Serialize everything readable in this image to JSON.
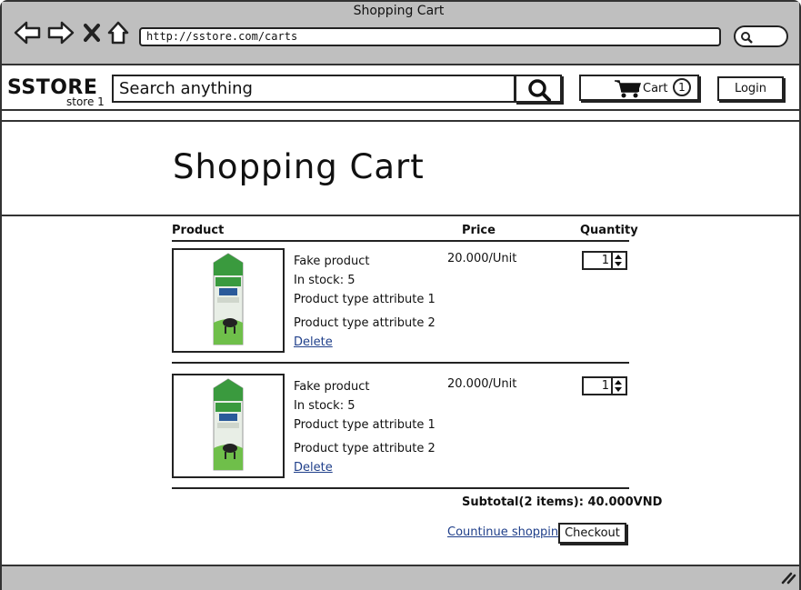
{
  "window": {
    "title": "Shopping Cart",
    "url": "http://sstore.com/carts"
  },
  "header": {
    "logo": "SSTORE",
    "store_label": "store 1",
    "search_placeholder": "Search anything",
    "cart_label": "Cart",
    "cart_count": "1",
    "login_label": "Login"
  },
  "page": {
    "title": "Shopping Cart"
  },
  "table": {
    "headers": {
      "product": "Product",
      "price": "Price",
      "quantity": "Quantity"
    },
    "items": [
      {
        "name": "Fake product",
        "stock": "In stock: 5",
        "attr1": "Product type attribute 1",
        "attr2": "Product type attribute 2",
        "delete_label": "Delete",
        "price": "20.000/Unit",
        "quantity": "1"
      },
      {
        "name": "Fake product",
        "stock": "In stock: 5",
        "attr1": "Product type attribute 1",
        "attr2": "Product type attribute 2",
        "delete_label": "Delete",
        "price": "20.000/Unit",
        "quantity": "1"
      }
    ]
  },
  "summary": {
    "subtotal": "Subtotal(2 items): 40.000VND",
    "continue_label": "Countinue shopping",
    "checkout_label": "Checkout"
  },
  "colors": {
    "chrome": "#bfbfbf",
    "link": "#1f3f8a",
    "milk_green": "#3a9a3e"
  }
}
